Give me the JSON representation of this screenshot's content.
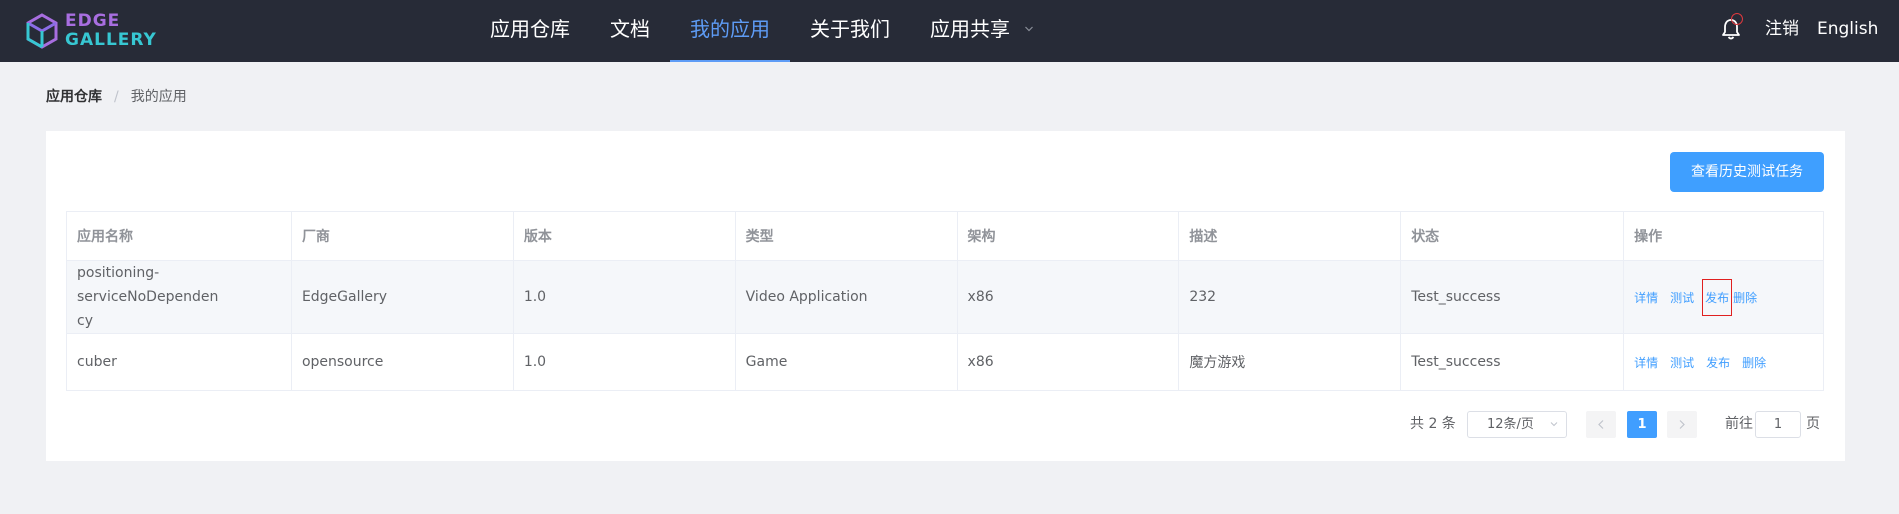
{
  "header": {
    "logo": {
      "line1": "EDGE",
      "line2": "GALLERY"
    },
    "nav": [
      {
        "label": "应用仓库"
      },
      {
        "label": "文档"
      },
      {
        "label": "我的应用"
      },
      {
        "label": "关于我们"
      },
      {
        "label": "应用共享"
      }
    ],
    "active_nav": "我的应用",
    "logout": "注销",
    "language": "English"
  },
  "breadcrumb": {
    "first": "应用仓库",
    "second": "我的应用"
  },
  "history_button": "查看历史测试任务",
  "table": {
    "columns": [
      "应用名称",
      "厂商",
      "版本",
      "类型",
      "架构",
      "描述",
      "状态",
      "操作"
    ],
    "rows": [
      {
        "name_line1": "positioning-serviceNoDependen",
        "name_line2": "cy",
        "vendor": "EdgeGallery",
        "version": "1.0",
        "type": "Video Application",
        "arch": "x86",
        "desc": "232",
        "status": "Test_success",
        "ops": [
          "详情",
          "测试",
          "发布",
          "删除"
        ]
      },
      {
        "name_line1": "cuber",
        "name_line2": "",
        "vendor": "opensource",
        "version": "1.0",
        "type": "Game",
        "arch": "x86",
        "desc": "魔方游戏",
        "status": "Test_success",
        "ops": [
          "详情",
          "测试",
          "发布",
          "删除"
        ]
      }
    ]
  },
  "pagination": {
    "total": "共 2 条",
    "page_size": "12条/页",
    "current_page": "1",
    "goto_label": "前往",
    "goto_value": "1",
    "page_suffix": "页"
  },
  "colors": {
    "header_bg": "#272b37",
    "accent": "#409eff",
    "active_nav": "#5e9cf6"
  }
}
